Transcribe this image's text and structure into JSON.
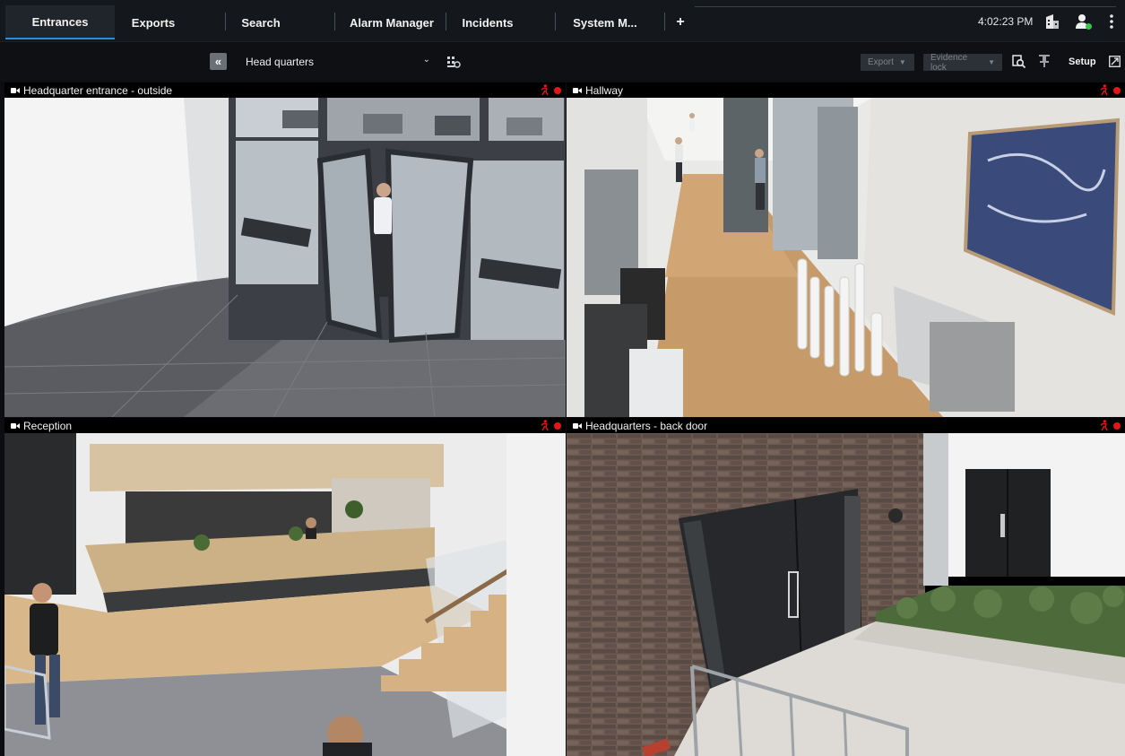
{
  "tabs": [
    {
      "label": "Entrances",
      "active": true
    },
    {
      "label": "Exports",
      "active": false
    },
    {
      "label": "Search",
      "active": false
    },
    {
      "label": "Alarm Manager",
      "active": false
    },
    {
      "label": "Incidents",
      "active": false
    },
    {
      "label": "System M...",
      "active": false
    }
  ],
  "add_tab_label": "+",
  "clock": "4:02:23 PM",
  "toolbar": {
    "collapse_icon": "double-chevron-left-icon",
    "view_selected": "Head quarters",
    "export_label": "Export",
    "evidence_lock_label": "Evidence lock",
    "setup_label": "Setup"
  },
  "cameras": [
    {
      "title": "Headquarter entrance - outside",
      "selected": true,
      "recording": true,
      "motion": true
    },
    {
      "title": "Hallway",
      "selected": false,
      "recording": true,
      "motion": true
    },
    {
      "title": "Reception",
      "selected": false,
      "recording": true,
      "motion": true
    },
    {
      "title": "Headquarters - back door",
      "selected": false,
      "recording": true,
      "motion": true
    }
  ],
  "colors": {
    "accent": "#2a8fd6",
    "recording": "#e51616",
    "background": "#0b0d10",
    "tab_bar": "#14171b"
  }
}
